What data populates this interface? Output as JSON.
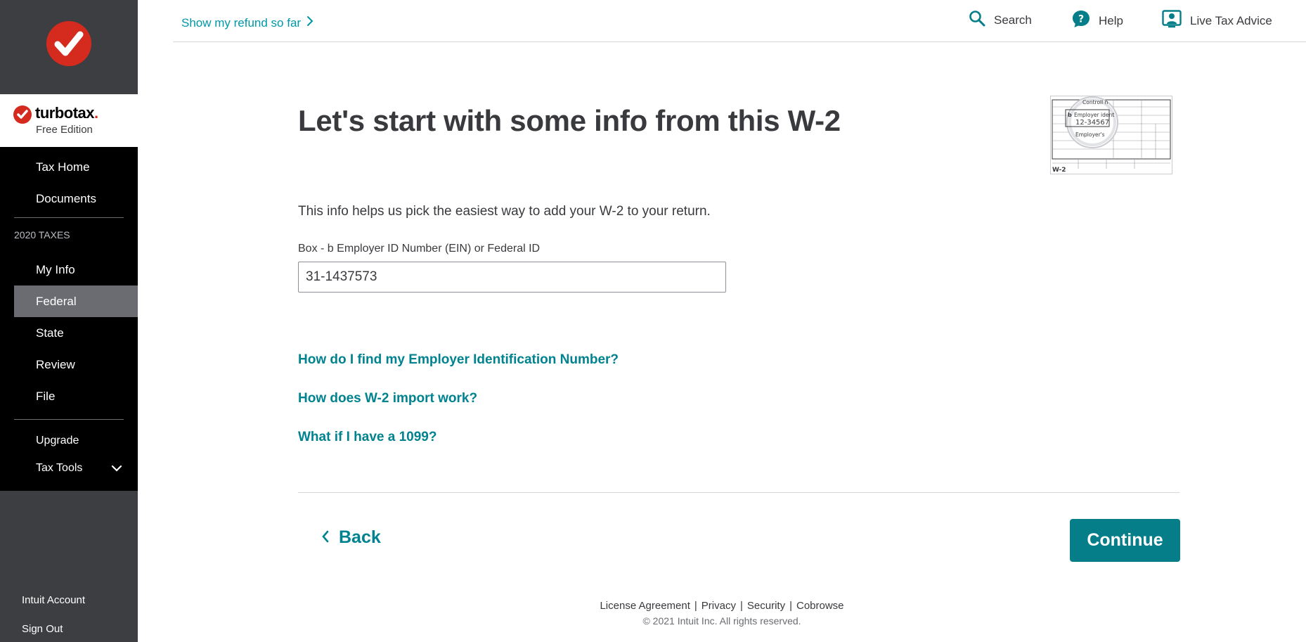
{
  "sidebar": {
    "brand": {
      "name": "turbotax",
      "dot": ".",
      "edition": "Free Edition"
    },
    "nav": {
      "tax_home": "Tax Home",
      "documents": "Documents",
      "section": "2020 TAXES",
      "my_info": "My Info",
      "federal": "Federal",
      "state": "State",
      "review": "Review",
      "file": "File",
      "upgrade": "Upgrade",
      "tax_tools": "Tax Tools"
    },
    "bottom": {
      "intuit_account": "Intuit Account",
      "sign_out": "Sign Out"
    }
  },
  "header": {
    "refund_link": "Show my refund so far",
    "search": "Search",
    "help": "Help",
    "live_advice": "Live Tax Advice"
  },
  "main": {
    "title": "Let's start with some info from this W-2",
    "intro": "This info helps us pick the easiest way to add your W-2 to your return.",
    "field_box": "Box - b",
    "field_label": "Employer ID Number (EIN) or Federal ID",
    "ein_value": "31-1437573",
    "w2_thumb": {
      "control": "Controll n",
      "box": "b",
      "employer_ident": "Employer ident",
      "number": "12-34567",
      "employers": "Employer's",
      "form": "W-2"
    },
    "links": [
      "How do I find my Employer Identification Number?",
      "How does W-2 import work?",
      "What if I have a 1099?"
    ],
    "back": "Back",
    "continue": "Continue"
  },
  "footer": {
    "links": [
      "License Agreement",
      "Privacy",
      "Security",
      "Cobrowse"
    ],
    "copyright": "© 2021 Intuit Inc. All rights reserved."
  },
  "colors": {
    "accent": "#057e8a",
    "link": "#00838f",
    "brand_red": "#d52b1e",
    "sidebar": "#3d3e42"
  }
}
